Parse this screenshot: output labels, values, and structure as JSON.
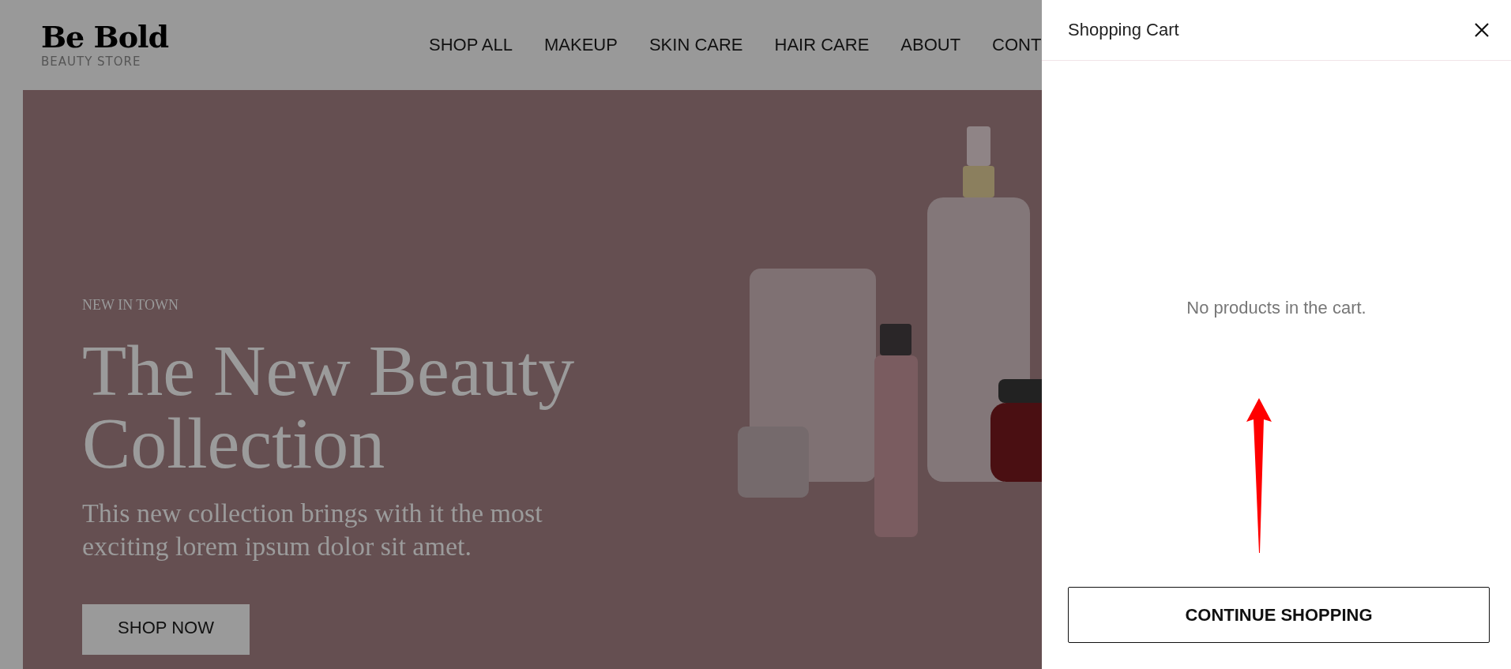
{
  "header": {
    "logo_title": "Be Bold",
    "logo_subtitle": "BEAUTY STORE",
    "nav": [
      {
        "label": "SHOP ALL"
      },
      {
        "label": "MAKEUP"
      },
      {
        "label": "SKIN CARE"
      },
      {
        "label": "HAIR CARE"
      },
      {
        "label": "ABOUT"
      },
      {
        "label": "CONT"
      }
    ]
  },
  "hero": {
    "eyebrow": "NEW IN TOWN",
    "headline": "The New Beauty Collection",
    "description": "This new collection brings with it the most exciting lorem ipsum dolor sit amet.",
    "button": "SHOP NOW"
  },
  "cart": {
    "title": "Shopping Cart",
    "empty_message": "No products in the cart.",
    "button": "CONTINUE SHOPPING"
  }
}
